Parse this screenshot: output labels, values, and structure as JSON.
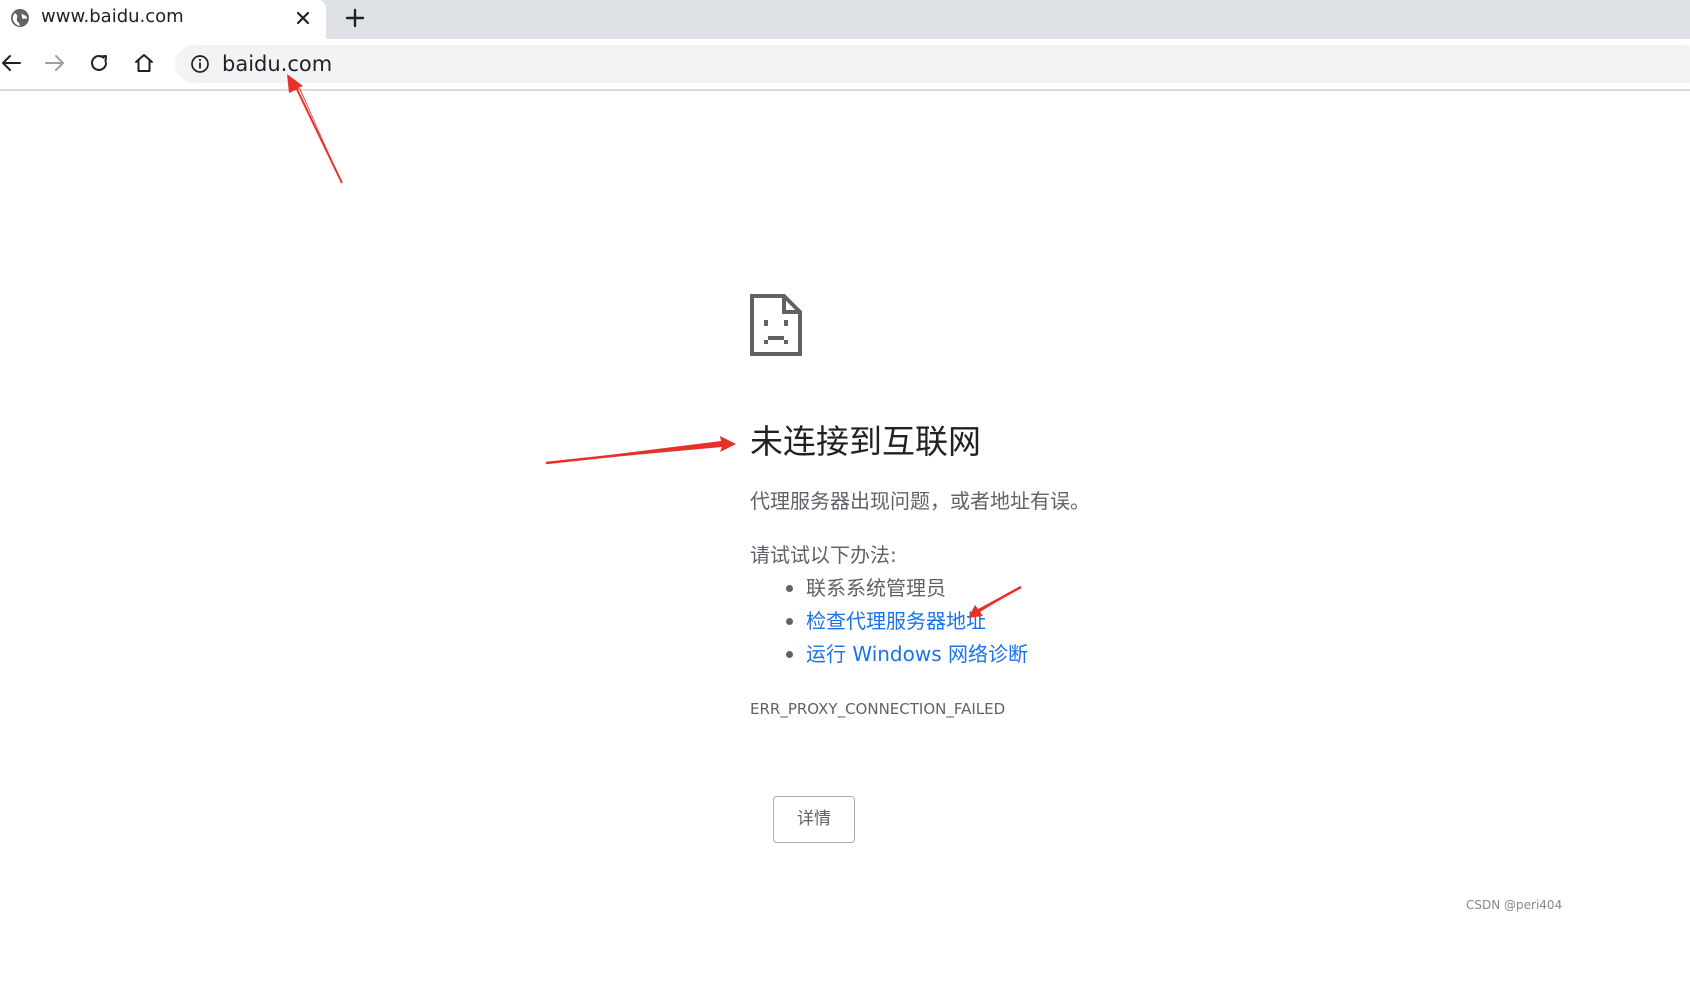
{
  "browser": {
    "tab": {
      "title": "www.baidu.com",
      "favicon": "globe-icon",
      "close_icon": "close-icon"
    },
    "new_tab_icon": "plus-icon",
    "toolbar": {
      "back_icon": "arrow-left-icon",
      "forward_icon": "arrow-right-icon",
      "reload_icon": "reload-icon",
      "home_icon": "home-icon",
      "site_info_icon": "info-icon",
      "url": "baidu.com"
    }
  },
  "error_page": {
    "icon": "sad-document-icon",
    "title": "未连接到互联网",
    "description": "代理服务器出现问题，或者地址有误。",
    "suggestions_heading": "请试试以下办法:",
    "suggestions": [
      {
        "label": "联系系统管理员",
        "link": false
      },
      {
        "label": "检查代理服务器地址",
        "link": true
      },
      {
        "label": "运行 Windows 网络诊断",
        "link": true
      }
    ],
    "error_code": "ERR_PROXY_CONNECTION_FAILED",
    "details_button": "详情"
  },
  "watermark": "CSDN @peri404",
  "colors": {
    "link": "#1a73e8",
    "annotation_arrow": "#e8302a",
    "tabstrip_bg": "#dee1e6",
    "omnibox_bg": "#f1f3f4"
  }
}
